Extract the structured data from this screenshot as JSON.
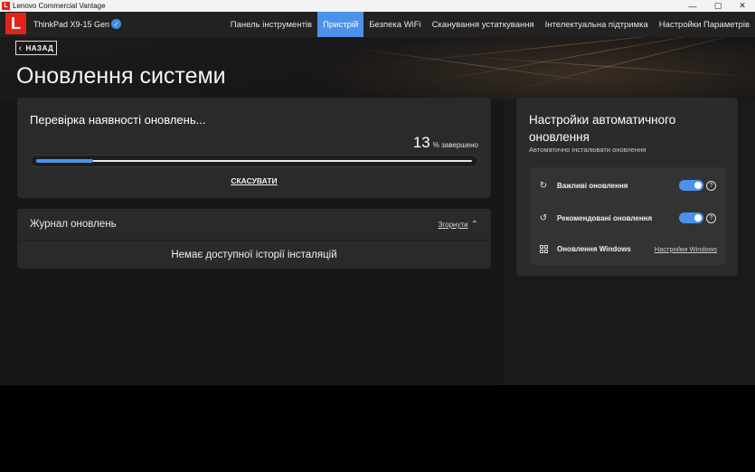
{
  "window": {
    "title": "Lenovo Commercial Vantage",
    "logo_letter": "L",
    "controls": {
      "minimize": "—",
      "maximize": "▢",
      "close": "✕"
    }
  },
  "header": {
    "logo_letter": "L",
    "device_name": "ThinkPad X9-15 Gen 1",
    "verified_icon": "checkmark-badge-icon",
    "nav": [
      {
        "label": "Панель інструментів",
        "active": false
      },
      {
        "label": "Пристрій",
        "active": true
      },
      {
        "label": "Безпека WiFi",
        "active": false
      },
      {
        "label": "Сканування устаткування",
        "active": false
      },
      {
        "label": "Інтелектуальна підтримка",
        "active": false
      },
      {
        "label": "Настройки Параметрів",
        "active": false
      }
    ]
  },
  "back_button": {
    "label": "НАЗАД",
    "icon": "chevron-left-icon"
  },
  "page_title": "Оновлення системи",
  "progress_card": {
    "title": "Перевірка наявності оновлень...",
    "percent": "13",
    "percent_label": "% завершено",
    "progress_fraction": 0.13,
    "cancel_label": "СКАСУВАТИ"
  },
  "history_card": {
    "title": "Журнал оновлень",
    "collapse_label": "Згорнути",
    "collapse_icon": "chevron-up-icon",
    "empty_text": "Немає доступної історії інсталяцій"
  },
  "auto_update_card": {
    "title": "Настройки автоматичного оновлення",
    "subtitle": "Автоматично інсталювати оновлення",
    "rows": [
      {
        "label": "Важливі оновлення",
        "icon": "sync-icon",
        "toggle_on": true,
        "help": "?"
      },
      {
        "label": "Рекомендовані оновлення",
        "icon": "sync-check-icon",
        "toggle_on": true,
        "help": "?"
      }
    ],
    "windows_row": {
      "label": "Оновлення Windows",
      "icon": "windows-icon",
      "link": "Настройки Windows"
    }
  },
  "colors": {
    "accent": "#4c92ea",
    "brand": "#e2231a",
    "card": "#2a2a2a"
  }
}
